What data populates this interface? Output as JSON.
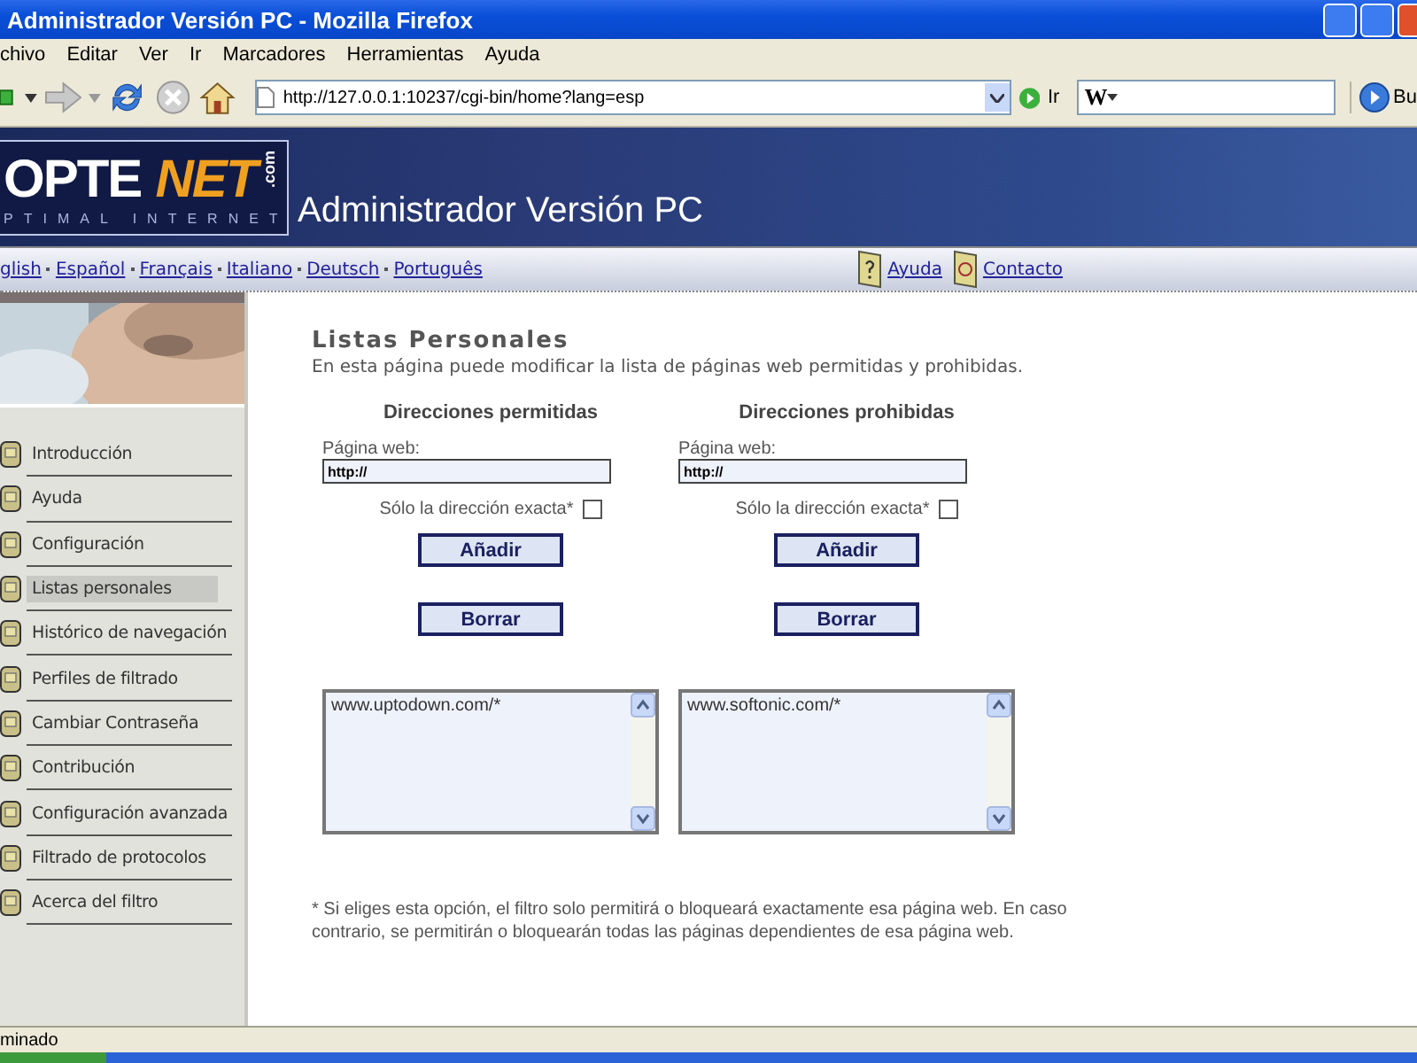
{
  "window": {
    "title": "Administrador Versión PC - Mozilla Firefox"
  },
  "menu_bar": [
    "chivo",
    "Editar",
    "Ver",
    "Ir",
    "Marcadores",
    "Herramientas",
    "Ayuda"
  ],
  "toolbar": {
    "url": "http://127.0.0.1:10237/cgi-bin/home?lang=esp",
    "go_label": "Ir",
    "search_engine": "W",
    "search_button": "Bu"
  },
  "banner": {
    "logo_left": "OPTE",
    "logo_right": "NET",
    "logo_domain": ".com",
    "logo_tagline": "PTIMAL INTERNET",
    "title": "Administrador Versión PC"
  },
  "languages": [
    "glish",
    "Español",
    "Français",
    "Italiano",
    "Deutsch",
    "Português"
  ],
  "help_links": [
    {
      "kind": "help",
      "label": "Ayuda"
    },
    {
      "kind": "contact",
      "label": "Contacto"
    }
  ],
  "sidebar": {
    "items": [
      {
        "label": "Introducción",
        "selected": false
      },
      {
        "label": "Ayuda",
        "selected": false
      },
      {
        "label": "Configuración",
        "selected": false
      },
      {
        "label": "Listas personales",
        "selected": true
      },
      {
        "label": "Histórico de navegación",
        "selected": false
      },
      {
        "label": "Perfiles de filtrado",
        "selected": false
      },
      {
        "label": "Cambiar Contraseña",
        "selected": false
      },
      {
        "label": "Contribución",
        "selected": false
      },
      {
        "label": "Configuración avanzada",
        "selected": false
      },
      {
        "label": "Filtrado de protocolos",
        "selected": false
      },
      {
        "label": "Acerca del filtro",
        "selected": false
      }
    ]
  },
  "content": {
    "title": "Listas Personales",
    "description": "En esta página puede modificar la lista de páginas web permitidas y prohibidas.",
    "lists": [
      {
        "heading": "Direcciones permitidas",
        "field_label": "Página web:",
        "value": "http://",
        "exact_label": "Sólo la dirección exacta*",
        "exact_checked": false,
        "add_button": "Añadir",
        "delete_button": "Borrar",
        "entries": [
          "www.uptodown.com/*"
        ]
      },
      {
        "heading": "Direcciones prohibidas",
        "field_label": "Página web:",
        "value": "http://",
        "exact_label": "Sólo la dirección exacta*",
        "exact_checked": false,
        "add_button": "Añadir",
        "delete_button": "Borrar",
        "entries": [
          "www.softonic.com/*"
        ]
      }
    ],
    "footnote": "* Si eliges esta opción, el filtro solo permitirá o bloqueará exactamente esa página web. En caso contrario, se permitirán o bloquearán todas las páginas dependientes de esa página web."
  },
  "status_bar": "minado"
}
